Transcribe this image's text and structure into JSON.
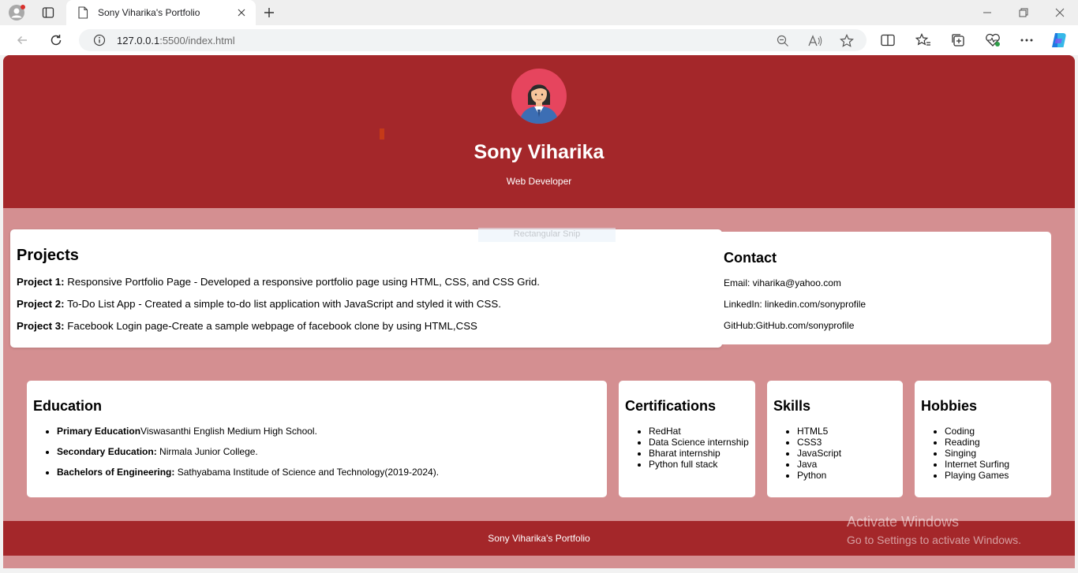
{
  "browser": {
    "tab_title": "Sony Viharika's Portfolio",
    "url_host": "127.0.0.1",
    "url_rest": ":5500/index.html"
  },
  "hero": {
    "name": "Sony Viharika",
    "role": "Web Developer"
  },
  "overlay": {
    "snip_label": "Rectangular Snip"
  },
  "projects": {
    "title": "Projects",
    "items": [
      {
        "label": "Project 1:",
        "text": " Responsive Portfolio Page - Developed a responsive portfolio page using HTML, CSS, and CSS Grid."
      },
      {
        "label": "Project 2:",
        "text": " To-Do List App - Created a simple to-do list application with JavaScript and styled it with CSS."
      },
      {
        "label": "Project 3:",
        "text": " Facebook Login page-Create a sample webpage of facebook clone by using HTML,CSS"
      }
    ]
  },
  "contact": {
    "title": "Contact",
    "email": "Email: viharika@yahoo.com",
    "linkedin": "LinkedIn: linkedin.com/sonyprofile",
    "github": "GitHub:GitHub.com/sonyprofile"
  },
  "education": {
    "title": "Education",
    "items": [
      {
        "label": "Primary Education",
        "text": "Viswasanthi English Medium High School."
      },
      {
        "label": "Secondary Education:",
        "text": " Nirmala Junior College."
      },
      {
        "label": "Bachelors of Engineering:",
        "text": " Sathyabama Institude of Science and Technology(2019-2024)."
      }
    ]
  },
  "certifications": {
    "title": "Certifications",
    "items": [
      "RedHat",
      "Data Science internship",
      "Bharat internship",
      "Python full stack"
    ]
  },
  "skills": {
    "title": "Skills",
    "items": [
      "HTML5",
      "CSS3",
      "JavaScript",
      "Java",
      "Python"
    ]
  },
  "hobbies": {
    "title": "Hobbies",
    "items": [
      "Coding",
      "Reading",
      "Singing",
      "Internet Surfing",
      "Playing Games"
    ]
  },
  "footer": {
    "text": "Sony Viharika's Portfolio"
  },
  "watermark": {
    "title": "Activate Windows",
    "subtitle": "Go to Settings to activate Windows."
  }
}
